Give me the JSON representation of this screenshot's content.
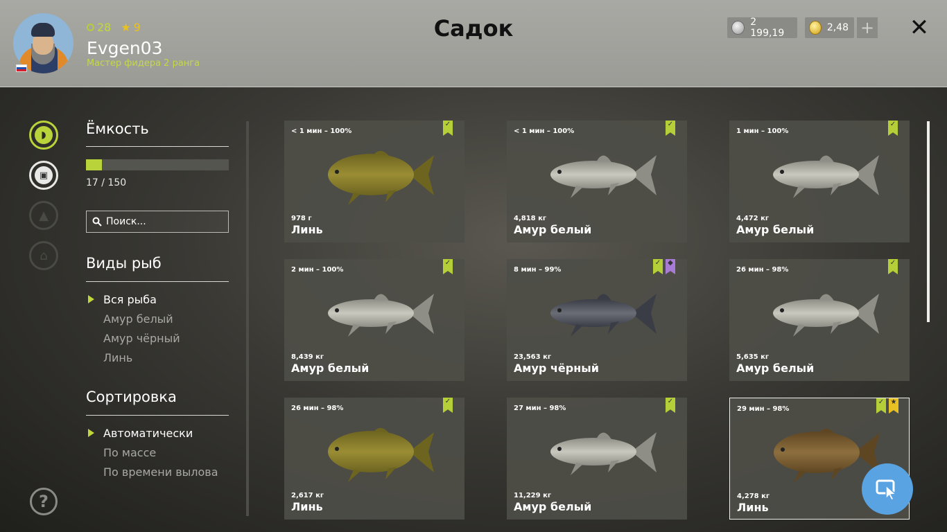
{
  "player": {
    "level": "28",
    "stars": "9",
    "username": "Evgen03",
    "rank": "Мастер фидера 2 ранга"
  },
  "header": {
    "title": "Садок",
    "silver": "2 199,19",
    "gold": "2,48",
    "plus_label": "+",
    "close_label": "✕"
  },
  "sidebar": {
    "capacity_title": "Ёмкость",
    "capacity_count": "17 / 150",
    "capacity_fraction": 0.113,
    "search_placeholder": "Поиск...",
    "species_title": "Виды рыб",
    "species": [
      "Вся рыба",
      "Амур белый",
      "Амур чёрный",
      "Линь"
    ],
    "species_selected": 0,
    "sort_title": "Сортировка",
    "sort": [
      "Автоматически",
      "По массе",
      "По времени вылова"
    ],
    "sort_selected": 0,
    "help_label": "?"
  },
  "fish": [
    {
      "time": "< 1 мин – 100%",
      "weight": "978 г",
      "name": "Линь",
      "kind": "tench",
      "badges": [
        "green"
      ]
    },
    {
      "time": "< 1 мин – 100%",
      "weight": "4,818 кг",
      "name": "Амур белый",
      "kind": "white",
      "badges": [
        "green"
      ]
    },
    {
      "time": "1 мин – 100%",
      "weight": "4,472 кг",
      "name": "Амур белый",
      "kind": "white",
      "badges": [
        "green"
      ]
    },
    {
      "time": "2 мин – 100%",
      "weight": "8,439 кг",
      "name": "Амур белый",
      "kind": "white",
      "badges": [
        "green"
      ]
    },
    {
      "time": "8 мин – 99%",
      "weight": "23,563 кг",
      "name": "Амур чёрный",
      "kind": "black",
      "badges": [
        "green",
        "purple"
      ]
    },
    {
      "time": "26 мин – 98%",
      "weight": "5,635 кг",
      "name": "Амур белый",
      "kind": "white",
      "badges": [
        "green"
      ]
    },
    {
      "time": "26 мин – 98%",
      "weight": "2,617 кг",
      "name": "Линь",
      "kind": "tench",
      "badges": [
        "green"
      ]
    },
    {
      "time": "27 мин – 98%",
      "weight": "11,229 кг",
      "name": "Амур белый",
      "kind": "white",
      "badges": [
        "green"
      ]
    },
    {
      "time": "29 мин – 98%",
      "weight": "4,278 кг",
      "name": "Линь",
      "kind": "tench-dark",
      "badges": [
        "green",
        "gold"
      ],
      "selected": true
    }
  ],
  "colors": {
    "accent": "#b9d33a",
    "tench": "#8a7f2e",
    "white_amur": "#b9b8ae",
    "black_amur": "#5b5d66",
    "tench_dark": "#7a5f34"
  }
}
